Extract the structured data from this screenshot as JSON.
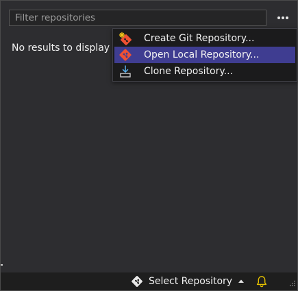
{
  "filter": {
    "placeholder": "Filter repositories",
    "value": ""
  },
  "more_button_icon": "ellipsis-icon",
  "empty_state": {
    "message": "No results to display"
  },
  "menu": {
    "items": [
      {
        "label": "Create Git Repository...",
        "icon": "create-git-repo-icon",
        "selected": false
      },
      {
        "label": "Open Local Repository...",
        "icon": "git-logo-icon",
        "selected": true
      },
      {
        "label": "Clone Repository...",
        "icon": "download-icon",
        "selected": false
      }
    ]
  },
  "status_bar": {
    "repo_label": "Select Repository",
    "repo_icon": "git-diamond-icon",
    "caret_icon": "caret-up-icon",
    "notifications_icon": "bell-icon"
  },
  "colors": {
    "background": "#2d2d30",
    "menu_background": "#1b1b1c",
    "menu_selected": "#3f3d91",
    "git_orange": "#f05133",
    "status_bar": "#1e1e1e",
    "bell_yellow": "#e6c200"
  }
}
